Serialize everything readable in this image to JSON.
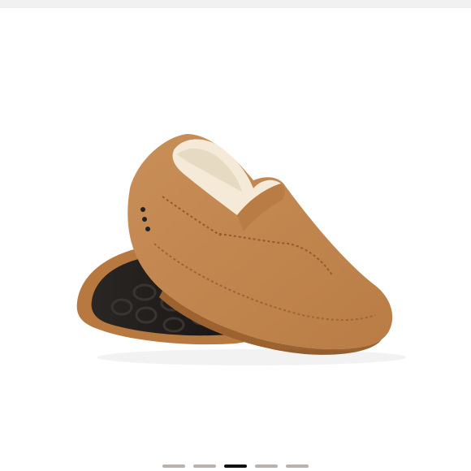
{
  "product_image": {
    "icon": "slipper-pair-image",
    "colors": {
      "suede": "#c68b52",
      "suede_shadow": "#a96f3c",
      "fleece": "#f4ead7",
      "sole": "#1d1a19",
      "background": "#ffffff"
    }
  },
  "pager": {
    "count": 5,
    "active_index": 2
  }
}
